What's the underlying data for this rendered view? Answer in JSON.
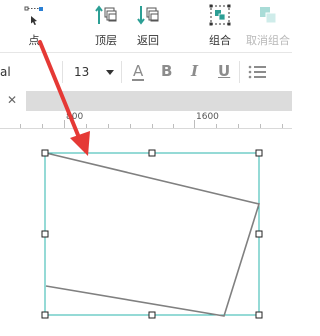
{
  "toolbar": {
    "point_label": "点",
    "top_layer_label": "顶层",
    "back_label": "返回",
    "group_label": "组合",
    "ungroup_label": "取消组合"
  },
  "format_bar": {
    "font_name": "al",
    "font_size": "13",
    "color_button": "A",
    "bold_button": "B",
    "italic_button": "I",
    "underline_button": "U"
  },
  "tabs": {
    "close_symbol": "✕"
  },
  "ruler": {
    "labels": [
      "800",
      "1600"
    ]
  },
  "colors": {
    "annotation_arrow": "#e53935",
    "selection": "#2bb5ad",
    "shape_stroke": "#808080",
    "toolbar_icon": "#2c9f95"
  }
}
